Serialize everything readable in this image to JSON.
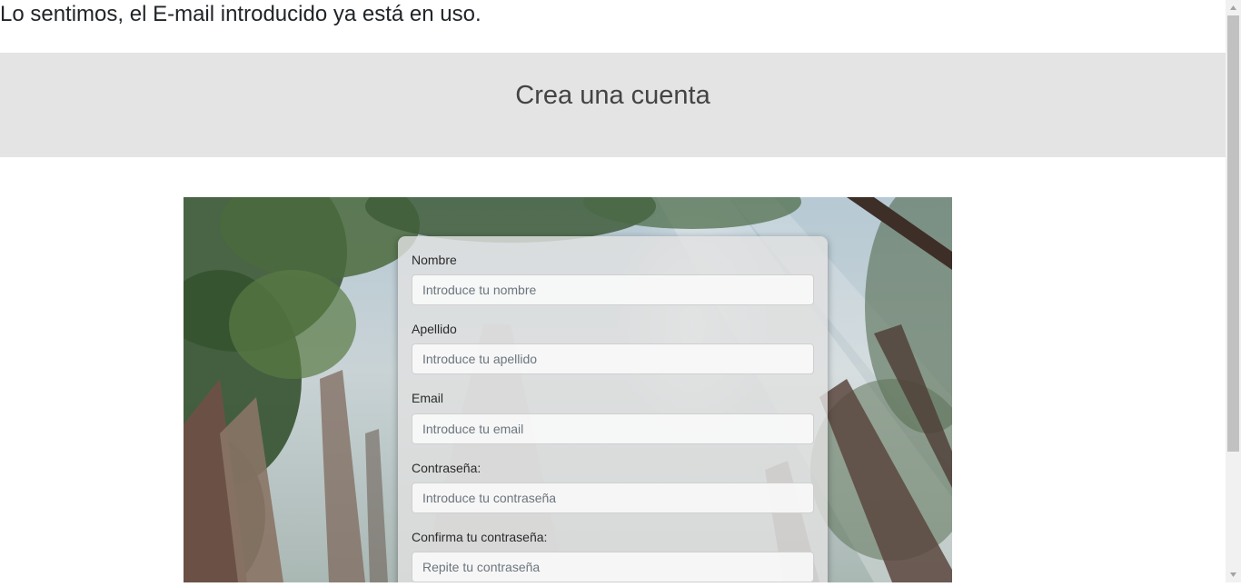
{
  "error_message": "Lo sentimos, el E-mail introducido ya está en uso.",
  "header": {
    "title": "Crea una cuenta"
  },
  "form": {
    "fields": [
      {
        "label": "Nombre",
        "placeholder": "Introduce tu nombre",
        "value": ""
      },
      {
        "label": "Apellido",
        "placeholder": "Introduce tu apellido",
        "value": ""
      },
      {
        "label": "Email",
        "placeholder": "Introduce tu email",
        "value": ""
      },
      {
        "label": "Contraseña:",
        "placeholder": "Introduce tu contraseña",
        "value": ""
      },
      {
        "label": "Confirma tu contraseña:",
        "placeholder": "Repite tu contraseña",
        "value": ""
      }
    ]
  },
  "background_image": "forest-photo",
  "colors": {
    "header_band": "#e4e4e4",
    "header_text": "#444444",
    "card": "#e1e1e1"
  }
}
